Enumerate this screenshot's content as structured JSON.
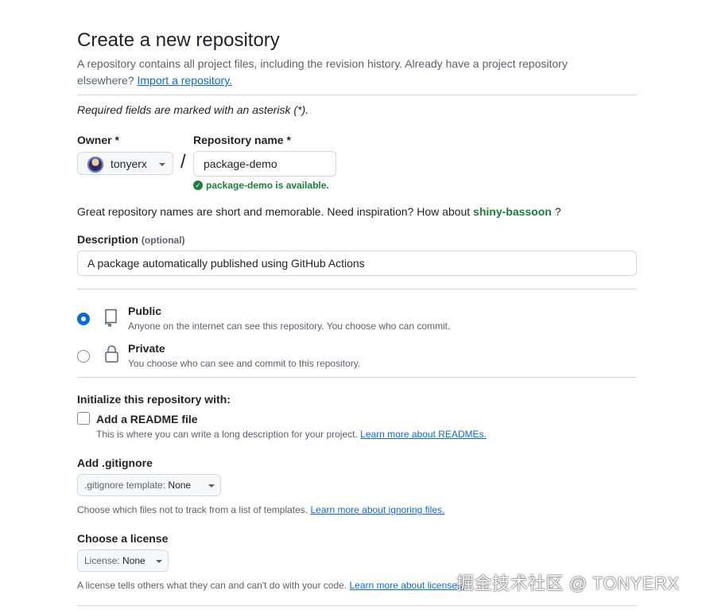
{
  "header": {
    "title": "Create a new repository",
    "subtitle_text": "A repository contains all project files, including the revision history. Already have a project repository elsewhere? ",
    "import_link": "Import a repository."
  },
  "required_note": "Required fields are marked with an asterisk (*).",
  "owner": {
    "label": "Owner *",
    "value": "tonyerx"
  },
  "separator": "/",
  "repo_name": {
    "label": "Repository name *",
    "value": "package-demo",
    "availability": "package-demo is available."
  },
  "inspiration": {
    "prefix": "Great repository names are short and memorable. Need inspiration? How about ",
    "suggestion": "shiny-bassoon",
    "suffix": " ?"
  },
  "description": {
    "label": "Description",
    "optional": "(optional)",
    "value": "A package automatically published using GitHub Actions"
  },
  "visibility": {
    "public": {
      "title": "Public",
      "desc": "Anyone on the internet can see this repository. You choose who can commit.",
      "selected": true
    },
    "private": {
      "title": "Private",
      "desc": "You choose who can see and commit to this repository.",
      "selected": false
    }
  },
  "initialize": {
    "heading": "Initialize this repository with:",
    "readme_label": "Add a README file",
    "readme_help": "This is where you can write a long description for your project. ",
    "readme_link": "Learn more about READMEs."
  },
  "gitignore": {
    "heading": "Add .gitignore",
    "select_prefix": ".gitignore template: ",
    "select_value": "None",
    "help": "Choose which files not to track from a list of templates. ",
    "link": "Learn more about ignoring files."
  },
  "license": {
    "heading": "Choose a license",
    "select_prefix": "License: ",
    "select_value": "None",
    "help": "A license tells others what they can and can't do with your code. ",
    "link": "Learn more about licenses."
  },
  "watermark": "掘金技术社区 @ TONYERX",
  "colors": {
    "accent": "#0969da",
    "success": "#1a7f37",
    "border": "#d1d9e0",
    "muted": "#59636e"
  }
}
